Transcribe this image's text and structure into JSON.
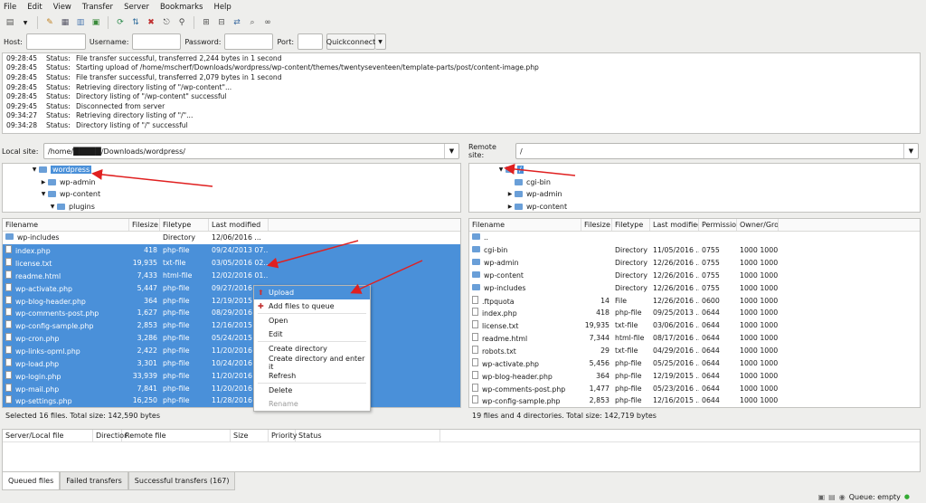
{
  "menu": [
    "File",
    "Edit",
    "View",
    "Transfer",
    "Server",
    "Bookmarks",
    "Help"
  ],
  "quickconnect": {
    "host_label": "Host:",
    "user_label": "Username:",
    "pass_label": "Password:",
    "port_label": "Port:",
    "button": "Quickconnect"
  },
  "log": [
    {
      "t": "09:28:45",
      "s": "Status:",
      "m": "File transfer successful, transferred 2,244 bytes in 1 second"
    },
    {
      "t": "09:28:45",
      "s": "Status:",
      "m": "Starting upload of /home/mscherf/Downloads/wordpress/wp-content/themes/twentyseventeen/template-parts/post/content-image.php"
    },
    {
      "t": "09:28:45",
      "s": "Status:",
      "m": "File transfer successful, transferred 2,079 bytes in 1 second"
    },
    {
      "t": "09:28:45",
      "s": "Status:",
      "m": "Retrieving directory listing of \"/wp-content\"..."
    },
    {
      "t": "09:28:45",
      "s": "Status:",
      "m": "Directory listing of \"/wp-content\" successful"
    },
    {
      "t": "09:29:45",
      "s": "Status:",
      "m": "Disconnected from server"
    },
    {
      "t": "09:34:27",
      "s": "Status:",
      "m": "Retrieving directory listing of \"/\"..."
    },
    {
      "t": "09:34:28",
      "s": "Status:",
      "m": "Directory listing of \"/\" successful"
    }
  ],
  "local": {
    "label": "Local site:",
    "path": "/home/█████/Downloads/wordpress/",
    "tree": [
      {
        "name": "wordpress",
        "depth": 0,
        "selected": true
      },
      {
        "name": "wp-admin",
        "depth": 1
      },
      {
        "name": "wp-content",
        "depth": 1
      },
      {
        "name": "plugins",
        "depth": 2
      }
    ],
    "headers": [
      "Filename",
      "Filesize",
      "Filetype",
      "Last modified"
    ],
    "rows": [
      [
        "wp-includes",
        "",
        "Directory",
        "12/06/2016 ..."
      ],
      [
        "index.php",
        "418",
        "php-file",
        "09/24/2013 07..."
      ],
      [
        "license.txt",
        "19,935",
        "txt-file",
        "03/05/2016 02..."
      ],
      [
        "readme.html",
        "7,433",
        "html-file",
        "12/02/2016 01..."
      ],
      [
        "wp-activate.php",
        "5,447",
        "php-file",
        "09/27/2016 04..."
      ],
      [
        "wp-blog-header.php",
        "364",
        "php-file",
        "12/19/2015 05..."
      ],
      [
        "wp-comments-post.php",
        "1,627",
        "php-file",
        "08/29/2016 07..."
      ],
      [
        "wp-config-sample.php",
        "2,853",
        "php-file",
        "12/16/2015 03..."
      ],
      [
        "wp-cron.php",
        "3,286",
        "php-file",
        "05/24/2015 12..."
      ],
      [
        "wp-links-opml.php",
        "2,422",
        "php-file",
        "11/20/2016 08..."
      ],
      [
        "wp-load.php",
        "3,301",
        "php-file",
        "10/24/2016 10..."
      ],
      [
        "wp-login.php",
        "33,939",
        "php-file",
        "11/20/2016 08..."
      ],
      [
        "wp-mail.php",
        "7,841",
        "php-file",
        "11/20/2016 08..."
      ],
      [
        "wp-settings.php",
        "16,250",
        "php-file",
        "11/28/2016 11..."
      ]
    ],
    "status": "Selected 16 files. Total size: 142,590 bytes"
  },
  "remote": {
    "label": "Remote site:",
    "path": "/",
    "tree": [
      {
        "name": "/",
        "depth": 0,
        "selected": true
      },
      {
        "name": "cgi-bin",
        "depth": 1
      },
      {
        "name": "wp-admin",
        "depth": 1
      },
      {
        "name": "wp-content",
        "depth": 1
      }
    ],
    "headers": [
      "Filename",
      "Filesize",
      "Filetype",
      "Last modified",
      "Permissions",
      "Owner/Grou"
    ],
    "rows": [
      [
        "..",
        "",
        "",
        "",
        "",
        ""
      ],
      [
        "cgi-bin",
        "",
        "Directory",
        "11/05/2016 ...",
        "0755",
        "1000 1000"
      ],
      [
        "wp-admin",
        "",
        "Directory",
        "12/26/2016 ...",
        "0755",
        "1000 1000"
      ],
      [
        "wp-content",
        "",
        "Directory",
        "12/26/2016 ...",
        "0755",
        "1000 1000"
      ],
      [
        "wp-includes",
        "",
        "Directory",
        "12/26/2016 ...",
        "0755",
        "1000 1000"
      ],
      [
        ".ftpquota",
        "14",
        "File",
        "12/26/2016 ...",
        "0600",
        "1000 1000"
      ],
      [
        "index.php",
        "418",
        "php-file",
        "09/25/2013 ...",
        "0644",
        "1000 1000"
      ],
      [
        "license.txt",
        "19,935",
        "txt-file",
        "03/06/2016 ...",
        "0644",
        "1000 1000"
      ],
      [
        "readme.html",
        "7,344",
        "html-file",
        "08/17/2016 ...",
        "0644",
        "1000 1000"
      ],
      [
        "robots.txt",
        "29",
        "txt-file",
        "04/29/2016 ...",
        "0644",
        "1000 1000"
      ],
      [
        "wp-activate.php",
        "5,456",
        "php-file",
        "05/25/2016 ...",
        "0644",
        "1000 1000"
      ],
      [
        "wp-blog-header.php",
        "364",
        "php-file",
        "12/19/2015 ...",
        "0644",
        "1000 1000"
      ],
      [
        "wp-comments-post.php",
        "1,477",
        "php-file",
        "05/23/2016 ...",
        "0644",
        "1000 1000"
      ],
      [
        "wp-config-sample.php",
        "2,853",
        "php-file",
        "12/16/2015 ...",
        "0644",
        "1000 1000"
      ]
    ],
    "status": "19 files and 4 directories. Total size: 142,719 bytes"
  },
  "context_menu": [
    "Upload",
    "Add files to queue",
    "Open",
    "Edit",
    "Create directory",
    "Create directory and enter it",
    "Refresh",
    "Delete",
    "Rename"
  ],
  "queue": {
    "headers": [
      "Server/Local file",
      "Directior",
      "Remote file",
      "Size",
      "Priority",
      "Status"
    ],
    "tabs": [
      "Queued files",
      "Failed transfers",
      "Successful transfers (167)"
    ]
  },
  "statusbar": {
    "queue": "Queue: empty"
  },
  "colors": {
    "selection": "#4a90d9",
    "annotation": "#e02020"
  }
}
